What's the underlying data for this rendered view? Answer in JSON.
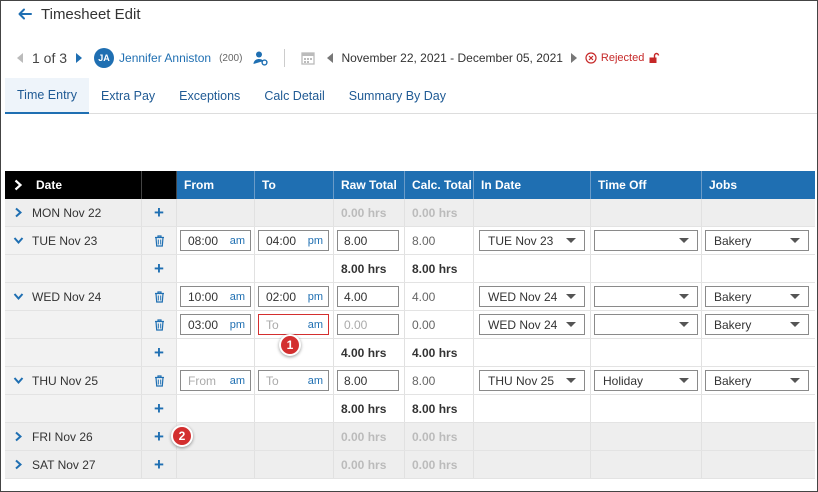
{
  "header": {
    "title": "Timesheet Edit",
    "pager": "1 of 3",
    "employee_initials": "JA",
    "employee_name": "Jennifer Anniston",
    "employee_id": "(200)",
    "date_range": "November 22, 2021 - December 05, 2021",
    "status": "Rejected",
    "status_color": "#c62828"
  },
  "tabs": [
    "Time Entry",
    "Extra Pay",
    "Exceptions",
    "Calc Detail",
    "Summary By Day"
  ],
  "table": {
    "columns": [
      "Date",
      "From",
      "To",
      "Raw Total",
      "Calc. Total",
      "In Date",
      "Time Off",
      "Jobs"
    ],
    "days": {
      "mon": {
        "label": "MON Nov 22",
        "raw": "0.00 hrs",
        "calc": "0.00 hrs"
      },
      "tue": {
        "label": "TUE Nov 23",
        "entry1": {
          "from": "08:00",
          "from_ap": "am",
          "to": "04:00",
          "to_ap": "pm",
          "raw": "8.00",
          "calc": "8.00",
          "in_date": "TUE Nov 23",
          "time_off": "",
          "job": "Bakery"
        },
        "raw_total": "8.00 hrs",
        "calc_total": "8.00 hrs"
      },
      "wed": {
        "label": "WED Nov 24",
        "entry1": {
          "from": "10:00",
          "from_ap": "am",
          "to": "02:00",
          "to_ap": "pm",
          "raw": "4.00",
          "calc": "4.00",
          "in_date": "WED Nov 24",
          "time_off": "",
          "job": "Bakery"
        },
        "entry2": {
          "from": "03:00",
          "from_ap": "pm",
          "to_placeholder": "To",
          "to_ap": "am",
          "raw_placeholder": "0.00",
          "calc": "0.00",
          "in_date": "WED Nov 24",
          "time_off": "",
          "job": "Bakery"
        },
        "raw_total": "4.00 hrs",
        "calc_total": "4.00 hrs"
      },
      "thu": {
        "label": "THU Nov 25",
        "entry1": {
          "from_placeholder": "From",
          "from_ap": "am",
          "to_placeholder": "To",
          "to_ap": "am",
          "raw": "8.00",
          "calc": "8.00",
          "in_date": "THU Nov 25",
          "time_off": "Holiday",
          "job": "Bakery"
        },
        "raw_total": "8.00 hrs",
        "calc_total": "8.00 hrs"
      },
      "fri": {
        "label": "FRI Nov 26",
        "raw": "0.00 hrs",
        "calc": "0.00 hrs"
      },
      "sat": {
        "label": "SAT Nov 27",
        "raw": "0.00 hrs",
        "calc": "0.00 hrs"
      }
    }
  },
  "callouts": {
    "one": "1",
    "two": "2"
  },
  "colors": {
    "accent": "#1f6fb2",
    "header_dark": "#000000",
    "callout": "#d32f2f"
  }
}
